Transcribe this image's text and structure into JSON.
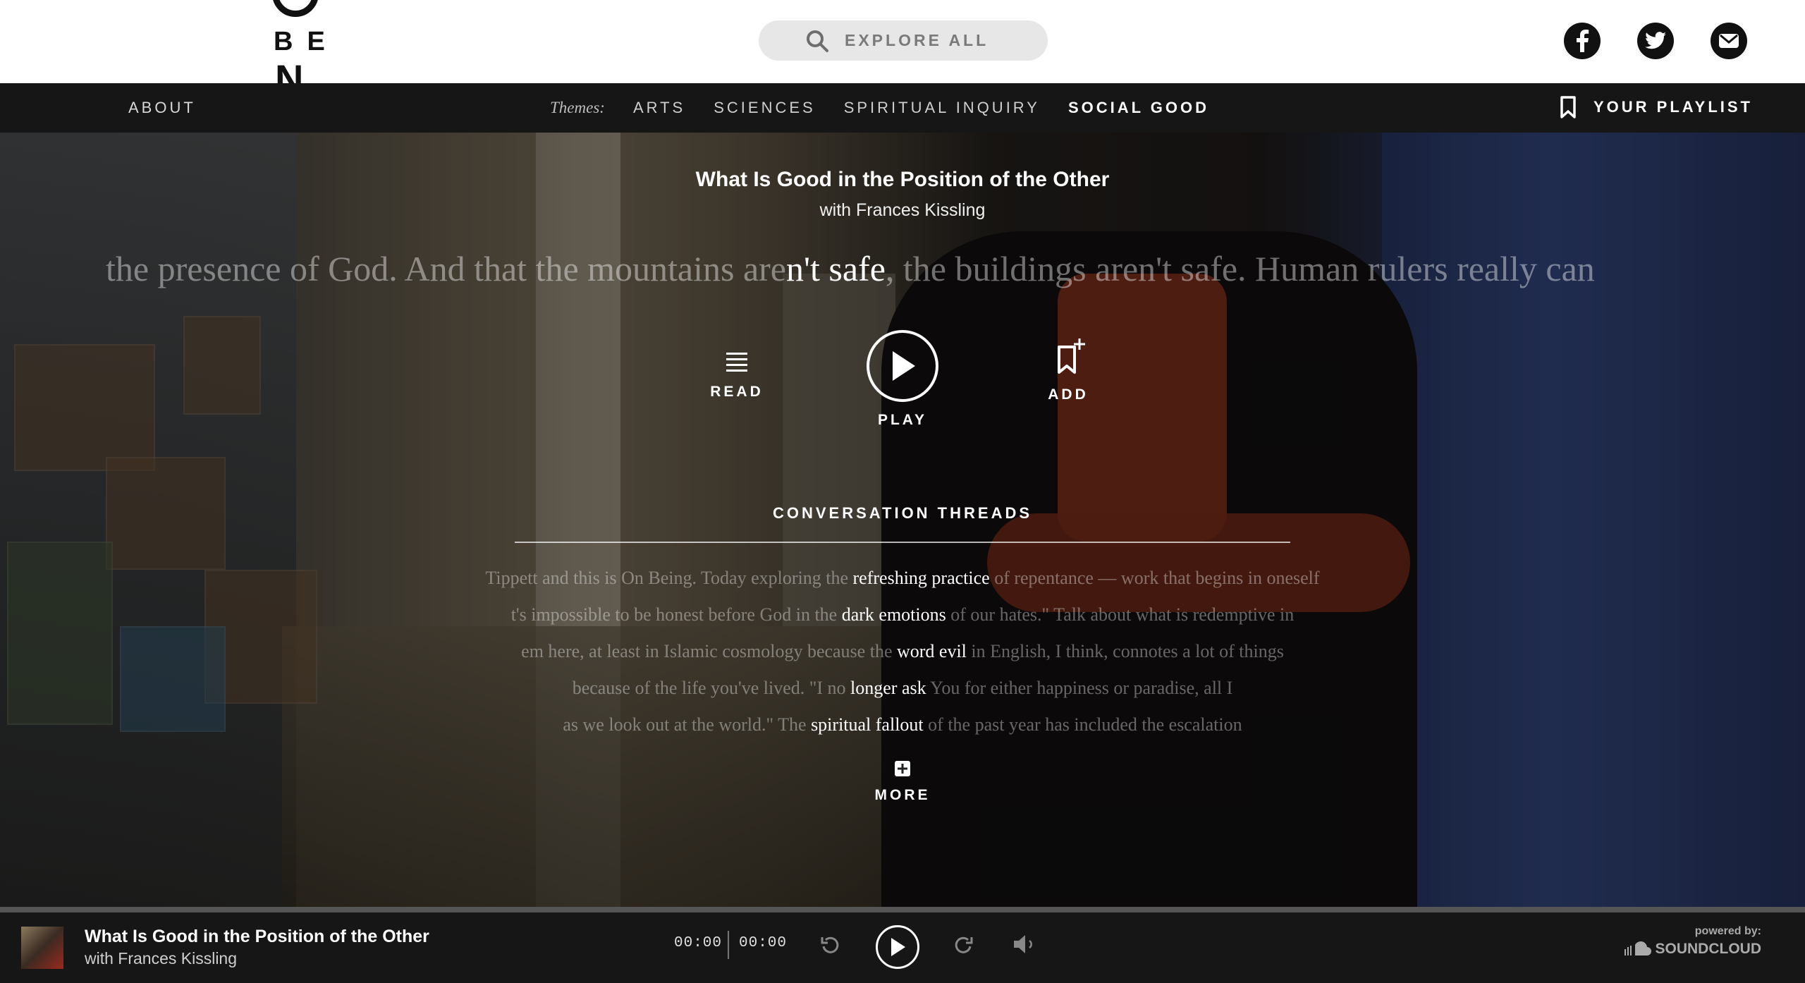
{
  "header": {
    "search_placeholder": "EXPLORE ALL",
    "social": [
      "facebook-icon",
      "twitter-icon",
      "mail-icon"
    ]
  },
  "nav": {
    "about": "ABOUT",
    "themes_label": "Themes:",
    "themes": [
      "ARTS",
      "SCIENCES",
      "SPIRITUAL INQUIRY",
      "SOCIAL GOOD"
    ],
    "active_theme": "SOCIAL GOOD",
    "playlist": "YOUR PLAYLIST"
  },
  "episode": {
    "title": "What Is Good in the Position of the Other",
    "guest": "with Frances Kissling",
    "quote_before": "the presence of God. And that the mountains are",
    "quote_highlight": "n't safe",
    "quote_after": ", the buildings aren't safe. Human rulers really can"
  },
  "actions": {
    "read": "READ",
    "play": "PLAY",
    "add": "ADD"
  },
  "threads": {
    "title": "CONVERSATION THREADS",
    "items": [
      {
        "before": "Tippett and this is On Being. Today exploring the ",
        "highlight": "refreshing practice",
        "after": " of repentance — work that begins in oneself"
      },
      {
        "before": "t's impossible to be honest before God in the ",
        "highlight": "dark emotions",
        "after": " of our hates.\" Talk about what is redemptive in"
      },
      {
        "before": "em here, at least in Islamic cosmology because the ",
        "highlight": "word evil",
        "after": " in English, I think, connotes a lot of things"
      },
      {
        "before": "because of the life you've lived. \"I no ",
        "highlight": "longer ask",
        "after": " You for either happiness or paradise, all I"
      },
      {
        "before": "as we look out at the world.\" The ",
        "highlight": "spiritual fallout",
        "after": " of the past year has included the escalation"
      }
    ],
    "more": "MORE"
  },
  "player": {
    "title": "What Is Good in the Position of the Other",
    "guest": "with Frances Kissling",
    "current_time": "00:00",
    "duration": "00:00",
    "powered_by": "powered by:",
    "provider": "SOUNDCLOUD"
  },
  "colors": {
    "header_bg": "#ffffff",
    "nav_bg": "#161616",
    "player_bg": "#161616",
    "search_bg": "#e7e7e7"
  }
}
